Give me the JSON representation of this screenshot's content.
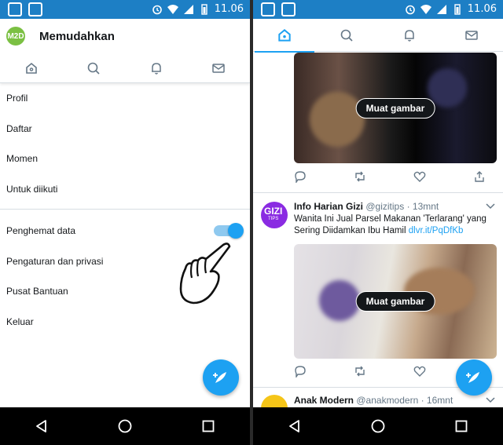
{
  "status_bar": {
    "time": "11.06"
  },
  "left_screen": {
    "header": {
      "avatar_text": "M2D",
      "title": "Memudahkan"
    },
    "tabs": [
      {
        "icon": "home-icon"
      },
      {
        "icon": "search-icon"
      },
      {
        "icon": "bell-icon"
      },
      {
        "icon": "mail-icon"
      }
    ],
    "menu_group_1": [
      {
        "label": "Profil"
      },
      {
        "label": "Daftar"
      },
      {
        "label": "Momen"
      },
      {
        "label": "Untuk diikuti"
      }
    ],
    "menu_group_2": [
      {
        "label": "Penghemat data",
        "toggle": true
      },
      {
        "label": "Pengaturan dan privasi"
      },
      {
        "label": "Pusat Bantuan"
      },
      {
        "label": "Keluar"
      }
    ]
  },
  "right_screen": {
    "tabs": [
      {
        "icon": "home-icon",
        "active": true
      },
      {
        "icon": "search-icon"
      },
      {
        "icon": "bell-icon"
      },
      {
        "icon": "mail-icon"
      }
    ],
    "tweets": [
      {
        "media_button": "Muat gambar"
      },
      {
        "avatar_text": "GIZI",
        "avatar_sub": "TIPS",
        "name": "Info Harian Gizi",
        "handle": "@gizitips",
        "time": "· 13mnt",
        "text": "Wanita Ini Jual Parsel Makanan 'Terlarang' yang Sering Diidamkan Ibu Hamil",
        "link": "dlvr.it/PqDfKb",
        "media_button": "Muat gambar"
      },
      {
        "name": "Anak Modern",
        "handle": "@anakmodern",
        "time": "· 16mnt"
      }
    ]
  },
  "colors": {
    "accent": "#1da1f2",
    "status_bar": "#1d7fc5",
    "text": "#14171a",
    "muted": "#657786"
  }
}
